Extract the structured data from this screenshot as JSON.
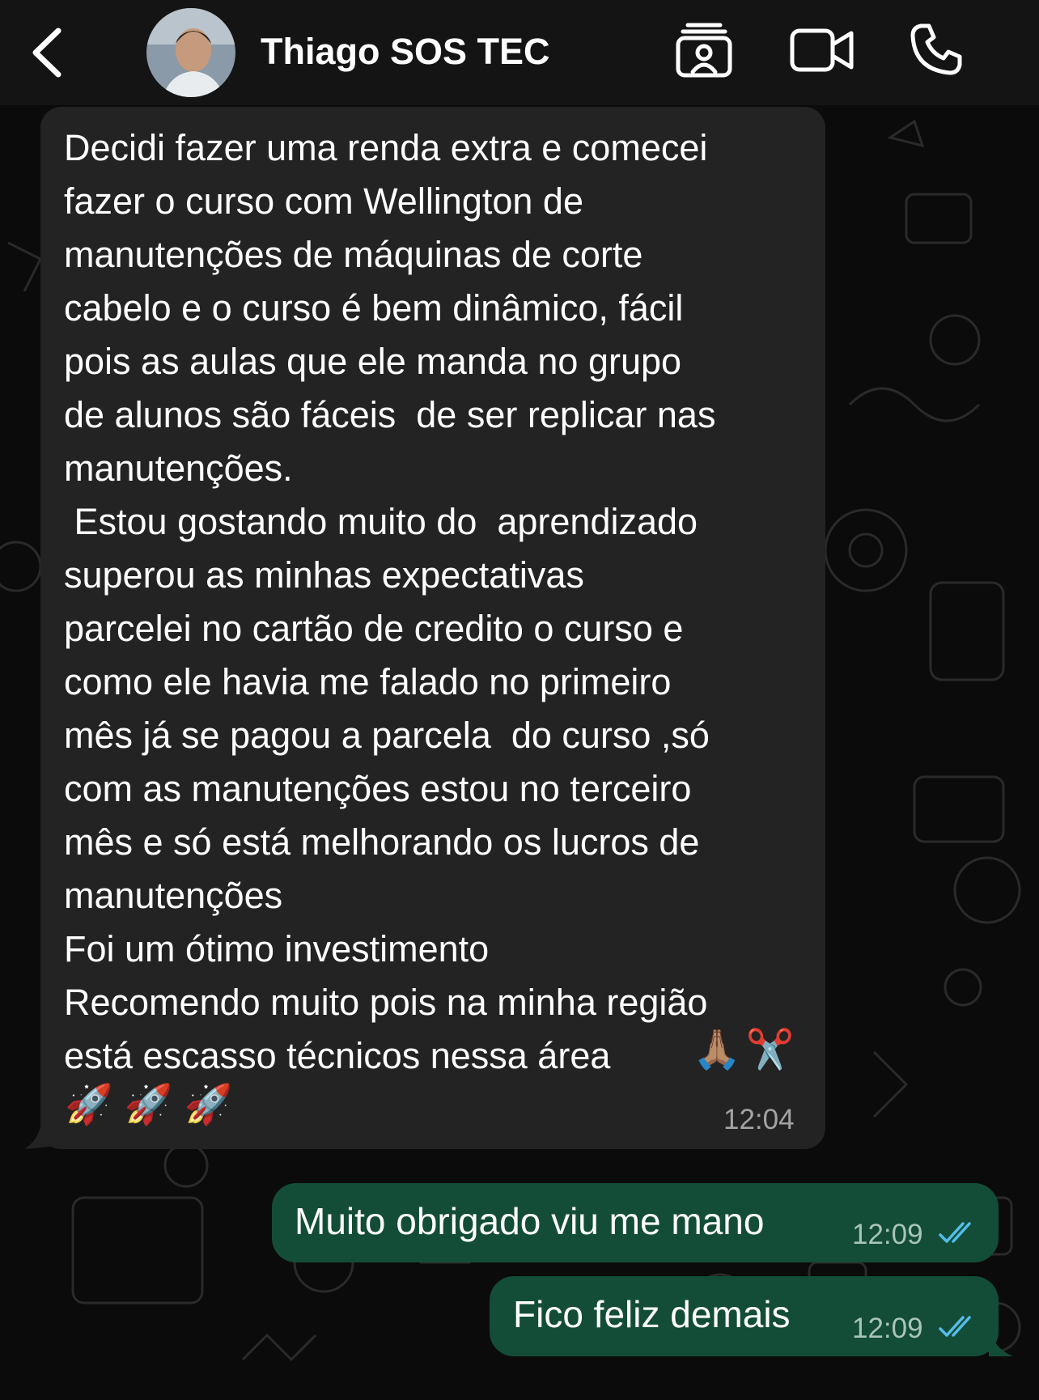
{
  "header": {
    "back_icon": "chevron-left-icon",
    "contact_name": "Thiago SOS TEC",
    "icons": [
      "contact-card-icon",
      "video-camera-icon",
      "phone-icon"
    ]
  },
  "messages": [
    {
      "direction": "incoming",
      "text": "Decidi fazer uma renda extra e comecei\nfazer o curso com Wellington de\nmanutenções de máquinas de corte\ncabelo e o curso é bem dinâmico, fácil\npois as aulas que ele manda no grupo\nde alunos são fáceis  de ser replicar nas\nmanutenções.\n Estou gostando muito do  aprendizado\nsuperou as minhas expectativas\nparcelei no cartão de credito o curso e\ncomo ele havia me falado no primeiro\nmês já se pagou a parcela  do curso ,só\ncom as manutenções estou no terceiro\nmês e só está melhorando os lucros de\nmanutenções\nFoi um ótimo investimento\nRecomendo muito pois na minha região\nestá escasso técnicos nessa área",
      "emojis": "🙏🏽✂️",
      "rockets": "🚀🚀🚀",
      "time": "12:04"
    },
    {
      "direction": "outgoing",
      "text": "Muito obrigado viu me mano",
      "time": "12:09",
      "status": "read"
    },
    {
      "direction": "outgoing",
      "text": "Fico feliz demais",
      "time": "12:09",
      "status": "read"
    }
  ],
  "colors": {
    "background": "#0b0b0b",
    "header": "#141414",
    "incoming_bubble": "#232323",
    "outgoing_bubble": "#134d37",
    "read_ticks": "#53bdeb"
  }
}
